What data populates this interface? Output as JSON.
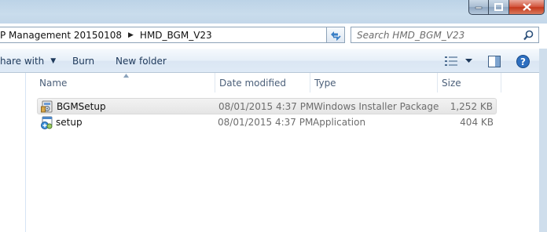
{
  "window": {
    "controls": {
      "minimize": "minimize-icon",
      "maximize": "maximize-icon",
      "close": "close-icon"
    }
  },
  "address": {
    "breadcrumbs": [
      "P Management 20150108",
      "HMD_BGM_V23"
    ],
    "separator_icon": "chevron-right-icon"
  },
  "search": {
    "placeholder": "Search HMD_BGM_V23"
  },
  "toolbar": {
    "share_label": "hare with",
    "burn_label": "Burn",
    "new_folder_label": "New folder"
  },
  "columns": [
    "Name",
    "Date modified",
    "Type",
    "Size"
  ],
  "files": [
    {
      "name": "BGMSetup",
      "date_modified": "08/01/2015 4:37 PM",
      "type": "Windows Installer Package",
      "size": "1,252 KB",
      "icon": "installer-package-icon",
      "selected": true
    },
    {
      "name": "setup",
      "date_modified": "08/01/2015 4:37 PM",
      "type": "Application",
      "size": "404 KB",
      "icon": "setup-application-icon",
      "selected": false
    }
  ],
  "colors": {
    "frame": "#c3d7e9",
    "command_text": "#1e395b",
    "header_text": "#4c607a",
    "meta_text": "#6d6d6d",
    "close_button": "#c4381c"
  }
}
